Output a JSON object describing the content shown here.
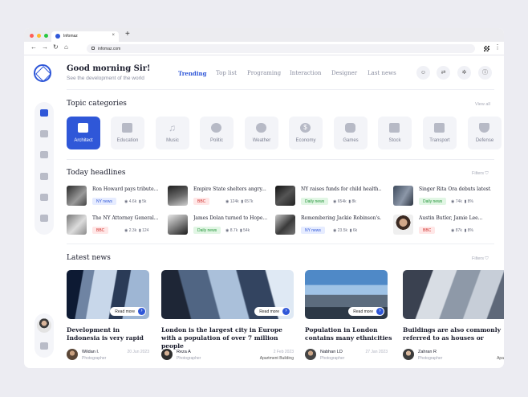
{
  "browser": {
    "tab_title": "Infomaz",
    "tab_close": "×",
    "new_tab": "+",
    "url": "infomaz.com",
    "back": "←",
    "forward": "→",
    "reload": "↻",
    "home": "⌂",
    "menu": "⋮"
  },
  "header": {
    "greeting": "Good morning Sir!",
    "subtitle": "See the development of the world",
    "nav": [
      "Trending",
      "Top list",
      "Programing",
      "Interaction",
      "Designer",
      "Last news"
    ],
    "buttons": [
      "☺",
      "⇄",
      "✲",
      "ⓘ"
    ]
  },
  "categories": {
    "title": "Topic categories",
    "view_all": "View all",
    "items": [
      "Architect",
      "Education",
      "Music",
      "Politic",
      "Weather",
      "Economy",
      "Games",
      "Stock",
      "Transport",
      "Defense"
    ],
    "icons": [
      "",
      "",
      "♫",
      "",
      "",
      "$",
      "",
      "",
      "",
      ""
    ]
  },
  "headlines": {
    "title": "Today headlines",
    "filter": "Filters ⛉",
    "items": [
      {
        "title": "Ron Howard pays tribute...",
        "badge": "NY news",
        "views": "◉ 4.6k",
        "likes": "▮ 5k"
      },
      {
        "title": "Empire State shelters angry...",
        "badge": "BBC",
        "views": "◉ 124k",
        "likes": "▮ 657k"
      },
      {
        "title": "NY raises funds for child health...",
        "badge": "Daily news",
        "views": "◉ 654k",
        "likes": "▮ 8k"
      },
      {
        "title": "Singer Rita Ora debuts latest...",
        "badge": "Daily news",
        "views": "◉ 74k",
        "likes": "▮ 8%"
      },
      {
        "title": "The NY Attorney General...",
        "badge": "BBC",
        "views": "◉ 2.3k",
        "likes": "▮ 124"
      },
      {
        "title": "James Dolan turned to Hope...",
        "badge": "Daily news",
        "views": "◉ 8.7k",
        "likes": "▮ 54k"
      },
      {
        "title": "Remembering Jackie Robinson's...",
        "badge": "NY news",
        "views": "◉ 23.5k",
        "likes": "▮ 6k"
      },
      {
        "title": "Austin Butler, Jamie Lee...",
        "badge": "BBC",
        "views": "◉ 87k",
        "likes": "▮ 8%"
      }
    ]
  },
  "latest": {
    "title": "Latest news",
    "filter": "Filters ⛉",
    "read_more": "Read more",
    "cards": [
      {
        "title": "Development in Indonesia is very rapid",
        "author": "Wildan I.",
        "role": "Photographer",
        "date": "20 Jun 2023",
        "category": ""
      },
      {
        "title": "London is the largest city in Europe with a population of over 7 million people",
        "author": "Reza A",
        "role": "Photographer",
        "date": "2 Feb 2023",
        "category": "Apartment Building"
      },
      {
        "title": "Population in London contains many ethnicities",
        "author": "Nabhan LD",
        "role": "Photographer",
        "date": "27 Jan 2023",
        "category": ""
      },
      {
        "title": "Buildings are also commonly referred to as houses or buildings",
        "author": "Zahran R",
        "role": "Photographer",
        "date": "",
        "category": "Apa"
      }
    ]
  },
  "colors": {
    "accent": "#2f57d8",
    "dark": "#1a1c2c",
    "muted": "#8a8ea0"
  }
}
